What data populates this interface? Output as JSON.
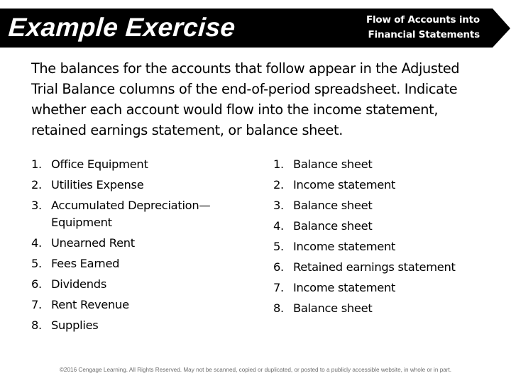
{
  "banner": {
    "title": "Example Exercise",
    "subtitle_line1": "Flow of Accounts into",
    "subtitle_line2": "Financial Statements",
    "background_color": "#000000",
    "text_color": "#ffffff",
    "shape_icon": "arrow-right-banner"
  },
  "intro": {
    "lines": [
      "The balances for the accounts that follow appear in the Adjusted",
      "Trial Balance columns of the end-of-period spreadsheet. Indicate",
      "whether each account would flow into the income statement,",
      "retained earnings statement, or balance sheet."
    ]
  },
  "accounts": [
    {
      "num": "1.",
      "label": "Office Equipment"
    },
    {
      "num": "2.",
      "label": "Utilities Expense"
    },
    {
      "num": "3.",
      "label": "Accumulated Depreciation— Equipment"
    },
    {
      "num": "4.",
      "label": "Unearned Rent"
    },
    {
      "num": "5.",
      "label": "Fees Earned"
    },
    {
      "num": "6.",
      "label": "Dividends"
    },
    {
      "num": "7.",
      "label": "Rent Revenue"
    },
    {
      "num": "8.",
      "label": "Supplies"
    }
  ],
  "answers": [
    {
      "num": "1.",
      "label": "Balance sheet"
    },
    {
      "num": "2.",
      "label": "Income statement"
    },
    {
      "num": "3.",
      "label": "Balance sheet"
    },
    {
      "num": "4.",
      "label": "Balance sheet"
    },
    {
      "num": "5.",
      "label": "Income statement"
    },
    {
      "num": "6.",
      "label": "Retained earnings statement"
    },
    {
      "num": "7.",
      "label": "Income statement"
    },
    {
      "num": "8.",
      "label": "Balance sheet"
    }
  ],
  "footer": {
    "text": "©2016 Cengage Learning. All Rights Reserved. May not be scanned, copied or duplicated, or posted to a publicly accessible website, in whole or in part.",
    "color": "#6e6e6e"
  }
}
